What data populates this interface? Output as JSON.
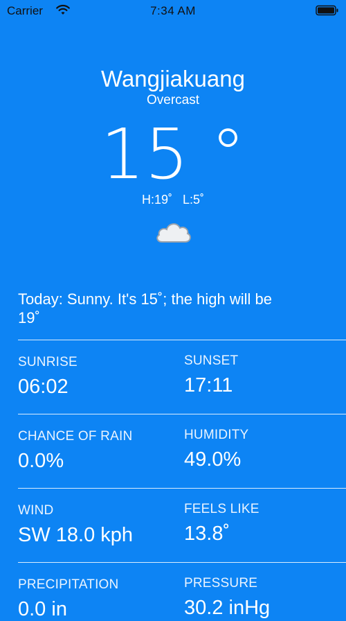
{
  "status_bar": {
    "carrier": "Carrier",
    "time": "7:34 AM"
  },
  "weather": {
    "city": "Wangjiakuang",
    "condition": "Overcast",
    "temperature": "15 °",
    "high": "H:19˚",
    "low": "L:5˚",
    "icon": "cloud-icon"
  },
  "summary": "Today: Sunny. It's 15˚; the high will be 19˚",
  "details": {
    "sunrise": {
      "label": "SUNRISE",
      "value": "06:02"
    },
    "sunset": {
      "label": "SUNSET",
      "value": "17:11"
    },
    "chance_of_rain": {
      "label": "CHANCE OF RAIN",
      "value": "0.0%"
    },
    "humidity": {
      "label": "HUMIDITY",
      "value": "49.0%"
    },
    "wind": {
      "label": "WIND",
      "value": "SW 18.0 kph"
    },
    "feels_like": {
      "label": "FEELS LIKE",
      "value": "13.8˚"
    },
    "precipitation": {
      "label": "PRECIPITATION",
      "value": "0.0 in"
    },
    "pressure": {
      "label": "PRESSURE",
      "value": "30.2 inHg"
    }
  },
  "colors": {
    "background": "#0d84f4",
    "text": "#ffffff"
  }
}
